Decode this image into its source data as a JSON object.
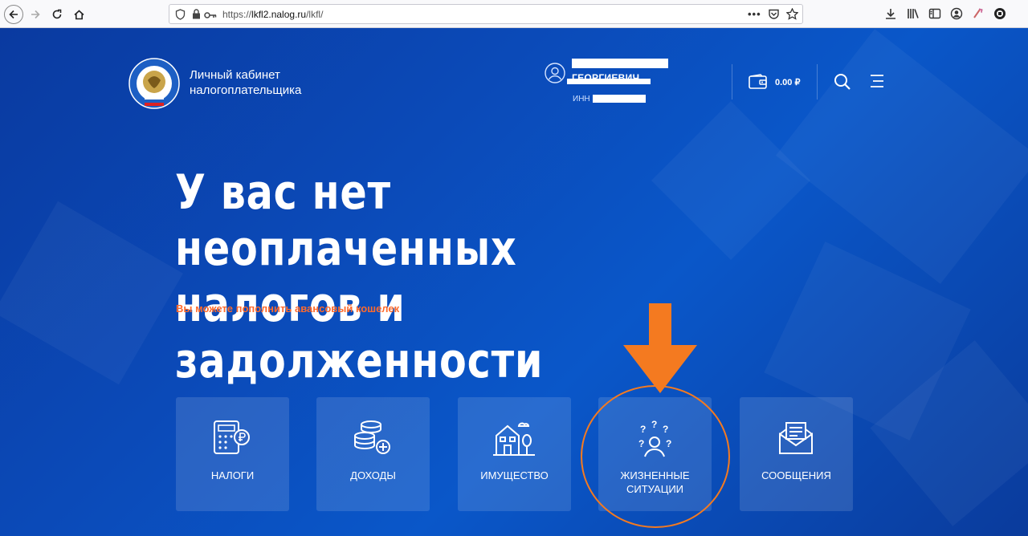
{
  "browser": {
    "url_prefix": "https://",
    "url_host": "lkfl2.nalog.ru",
    "url_path": "/lkfl/",
    "icons": [
      "back-icon",
      "forward-icon",
      "reload-icon",
      "home-icon",
      "shield-icon",
      "lock-icon",
      "key-icon",
      "more-icon",
      "pocket-icon",
      "star-icon",
      "download-icon",
      "library-icon",
      "sidebar-icon",
      "account-icon",
      "extension-icon",
      "addon-icon"
    ]
  },
  "header": {
    "brand_line1": "Личный кабинет",
    "brand_line2": "налогоплательщика",
    "user_name": "ГЕОРГИЕВИЧ",
    "inn_label": "ИНН",
    "balance": "0.00 ₽"
  },
  "hero": {
    "headline_line1": "У вас нет неоплаченных",
    "headline_line2": "налогов и задолженности",
    "subline": "Вы можете пополнить авансовый кошелек"
  },
  "tiles": [
    {
      "label": "НАЛОГИ",
      "icon": "calculator-ruble-icon"
    },
    {
      "label": "ДОХОДЫ",
      "icon": "coins-plus-icon"
    },
    {
      "label": "ИМУЩЕСТВО",
      "icon": "house-icon"
    },
    {
      "label": "ЖИЗНЕННЫЕ",
      "label2": "СИТУАЦИИ",
      "icon": "person-questions-icon"
    },
    {
      "label": "СООБЩЕНИЯ",
      "icon": "envelope-icon"
    }
  ],
  "colors": {
    "accent_orange": "#f47a20",
    "subline_orange": "#ff6a2c",
    "bg_blue": "#0b4ab8"
  }
}
